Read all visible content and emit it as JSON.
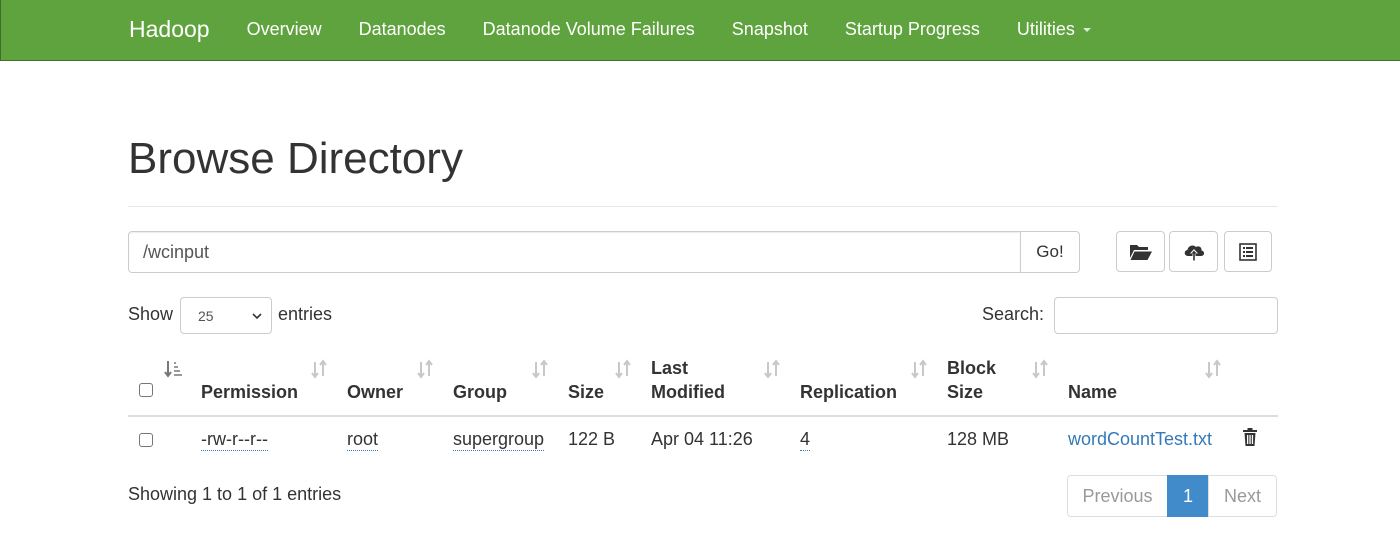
{
  "navbar": {
    "brand": "Hadoop",
    "links": [
      "Overview",
      "Datanodes",
      "Datanode Volume Failures",
      "Snapshot",
      "Startup Progress",
      "Utilities"
    ],
    "color": "#5fa33e"
  },
  "page": {
    "title": "Browse Directory"
  },
  "path_bar": {
    "value": "/wcinput",
    "go_label": "Go!",
    "icons": [
      "folder-open-icon",
      "cloud-upload-icon",
      "list-icon"
    ]
  },
  "controls": {
    "show_label": "Show",
    "page_size": "25",
    "entries_label": "entries",
    "search_label": "Search:",
    "search_value": ""
  },
  "table": {
    "columns": [
      "Permission",
      "Owner",
      "Group",
      "Size",
      "Last Modified",
      "Replication",
      "Block Size",
      "Name"
    ],
    "rows": [
      {
        "permission": "-rw-r--r--",
        "owner": "root",
        "group": "supergroup",
        "size": "122 B",
        "last_modified": "Apr 04 11:26",
        "replication": "4",
        "block_size": "128 MB",
        "name": "wordCountTest.txt"
      }
    ]
  },
  "footer": {
    "info": "Showing 1 to 1 of 1 entries",
    "pagination": {
      "previous": "Previous",
      "current": "1",
      "next": "Next"
    }
  },
  "colors": {
    "link": "#337ab7",
    "active_page": "#428bca"
  }
}
